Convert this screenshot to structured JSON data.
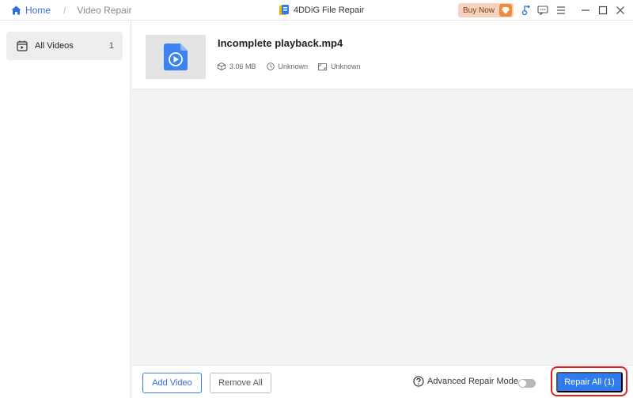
{
  "titlebar": {
    "breadcrumb": {
      "home_label": "Home",
      "separator": "/",
      "current": "Video Repair"
    },
    "app_title": "4DDiG File Repair",
    "buy_now_label": "Buy Now",
    "icons": [
      "home-icon",
      "app-logo-icon",
      "gem-icon",
      "link-icon",
      "feedback-icon",
      "menu-icon",
      "minimize-icon",
      "maximize-icon",
      "close-icon"
    ]
  },
  "sidebar": {
    "items": [
      {
        "label": "All Videos",
        "count": "1",
        "icon": "video-folder-icon",
        "selected": true
      }
    ]
  },
  "main": {
    "files": [
      {
        "name": "Incomplete playback.mp4",
        "size": "3.06 MB",
        "duration": "Unknown",
        "resolution": "Unknown"
      }
    ]
  },
  "footer": {
    "add_video_label": "Add Video",
    "remove_all_label": "Remove All",
    "advanced_mode_label": "Advanced Repair Mode",
    "advanced_mode_enabled": false,
    "repair_all_label": "Repair All (1)"
  },
  "colors": {
    "accent": "#2f7bf0",
    "highlight": "#e02020",
    "buy_now_bg": "#f5d2bf",
    "gem": "#f08b3a"
  }
}
